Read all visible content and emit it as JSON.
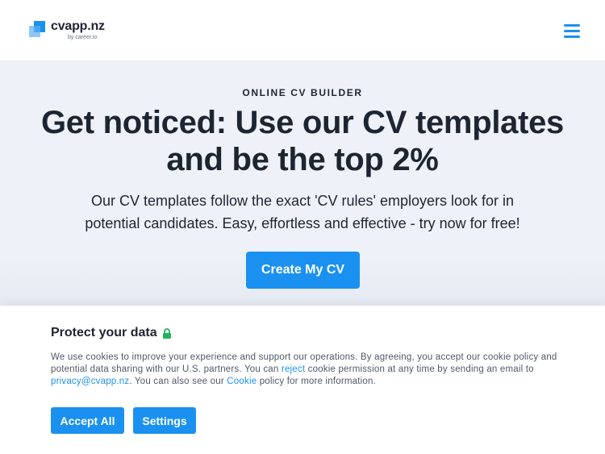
{
  "header": {
    "brand_name": "cvapp.nz",
    "brand_sub": "by career.io",
    "menu_icon": "hamburger-menu-icon",
    "accent_color": "#1a91f0"
  },
  "hero": {
    "eyebrow": "ONLINE CV BUILDER",
    "headline_line1": "Get noticed: Use our CV templates",
    "headline_line2": "and be the top 2%",
    "subhead_line1": "Our CV templates follow the exact 'CV rules' employers look for in",
    "subhead_line2": "potential candidates. Easy, effortless and effective - try now for free!",
    "cta_label": "Create My CV"
  },
  "cookie_banner": {
    "title": "Protect your data",
    "title_icon": "lock-icon",
    "text_part1": "We use cookies to improve your experience and support our operations. By agreeing, you accept our cookie policy and potential data sharing with our U.S. partners. You can ",
    "link_reject": "reject",
    "text_part2": " cookie permission at any time by sending an email to ",
    "link_email": "privacy@cvapp.nz",
    "text_part3": ". You can also see our ",
    "link_cookie": "Cookie",
    "text_part4": " policy for more information.",
    "accept_label": "Accept All",
    "settings_label": "Settings"
  }
}
